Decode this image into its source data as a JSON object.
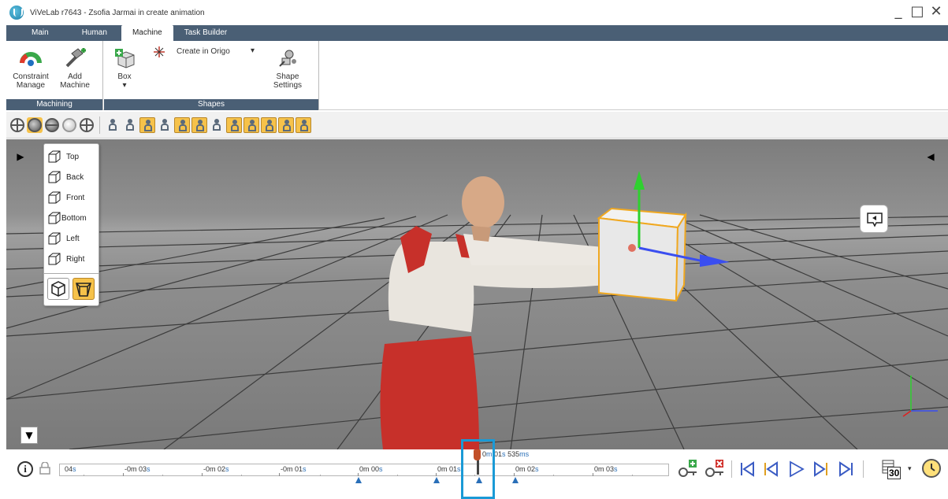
{
  "window": {
    "title": "ViVeLab r7643 - Zsofia Jarmai in create animation",
    "controls": [
      "_",
      "□",
      "✕"
    ]
  },
  "menu": {
    "tabs": [
      {
        "label": "Main",
        "active": false
      },
      {
        "label": "Human",
        "active": false
      },
      {
        "label": "Machine",
        "active": true
      },
      {
        "label": "Task Builder",
        "active": false
      }
    ]
  },
  "ribbon": {
    "groups": [
      {
        "label": "Machining",
        "buttons": [
          {
            "label": "Constraint\nManage",
            "icon": "gauge-icon"
          },
          {
            "label": "Add\nMachine",
            "icon": "hammer-add-icon"
          }
        ]
      },
      {
        "label": "Shapes",
        "buttons": [
          {
            "label": "Box",
            "icon": "box-add-icon",
            "dropdown": "▾"
          },
          {
            "label": "Create in Origo",
            "icon": "origin-star-icon",
            "dropdown": "▾"
          },
          {
            "label": "Shape\nSettings",
            "icon": "shape-settings-icon"
          }
        ]
      }
    ]
  },
  "views": {
    "items": [
      "Top",
      "Back",
      "Front",
      "Bottom",
      "Left",
      "Right"
    ],
    "projection": [
      "perspective",
      "orthographic"
    ],
    "active_projection": "orthographic"
  },
  "timeline": {
    "tick_labels": [
      {
        "num": "04",
        "unit": "s"
      },
      {
        "num": "-0m 03",
        "unit": "s"
      },
      {
        "num": "-0m 02",
        "unit": "s"
      },
      {
        "num": "-0m 01",
        "unit": "s"
      },
      {
        "num": "0m 00",
        "unit": "s"
      },
      {
        "num": "0m 01",
        "unit": "s"
      },
      {
        "num": "0m 02",
        "unit": "s"
      },
      {
        "num": "0m 03",
        "unit": "s"
      }
    ],
    "current_time": {
      "m": "0",
      "m_unit": "m",
      "s": "01",
      "s_unit": "s",
      "ms": "535",
      "ms_unit": "ms"
    },
    "fps": "30",
    "dropdown": "▾",
    "info": "i"
  },
  "colors": {
    "accent": "#4a5f75",
    "highlight": "#f6c24a",
    "selection": "#1a9ad6",
    "keyframe": "#2a6fb8"
  }
}
